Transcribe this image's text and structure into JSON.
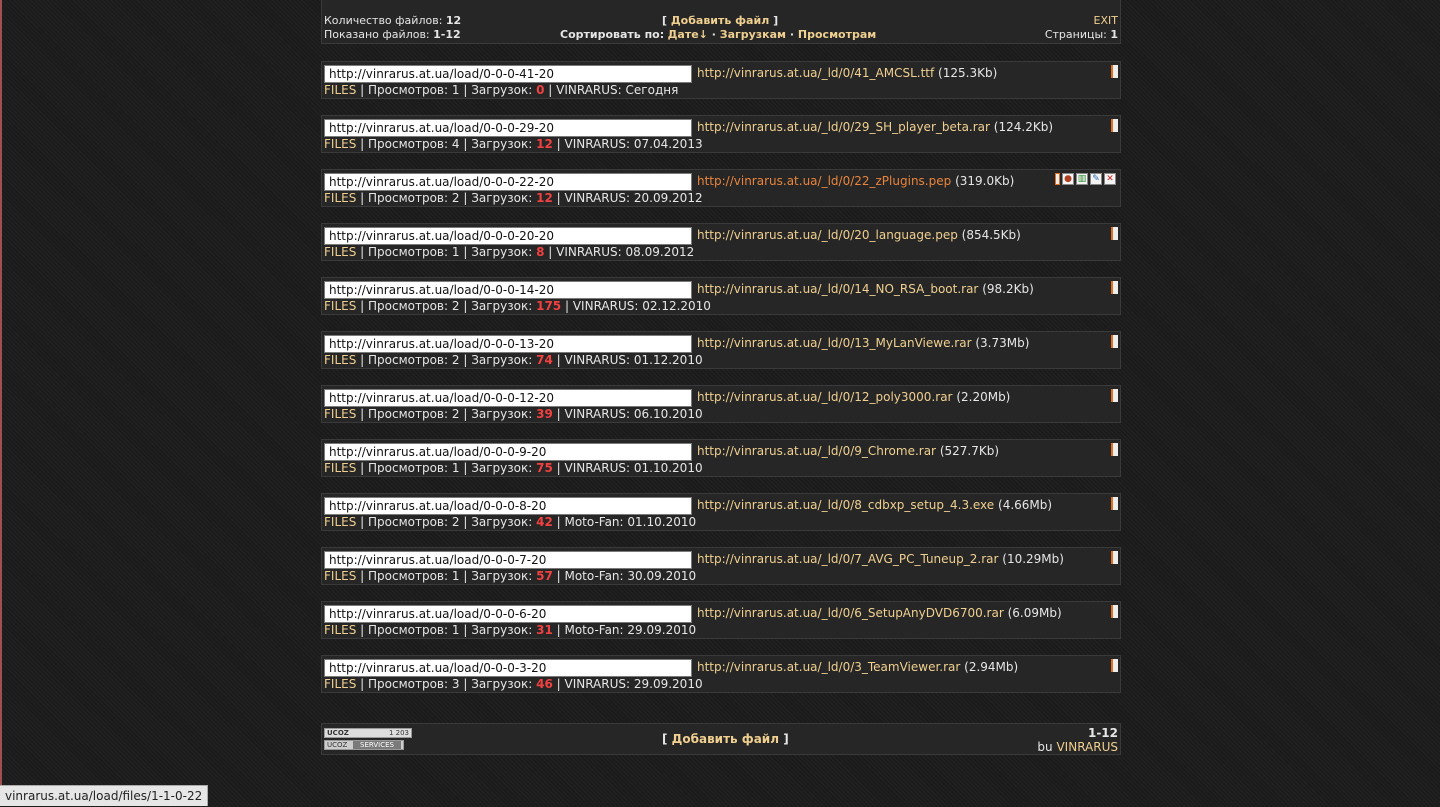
{
  "header": {
    "files_count_label": "Количество файлов:",
    "files_count": "12",
    "shown_label": "Показано файлов:",
    "shown_range": "1-12",
    "add_open": "[ ",
    "add_link": "Добавить файл",
    "add_close": " ]",
    "sort_label": "Сортировать по:",
    "sort_date": "Дате↓",
    "sort_downloads": "Загрузкам",
    "sort_views": "Просмотрам",
    "sep": " · ",
    "exit": "EXIT",
    "pages_label": "Страницы:",
    "pages_value": "1"
  },
  "labels": {
    "views": "Просмотров:",
    "downloads": "Загрузок:",
    "pipe": " | "
  },
  "files": [
    {
      "page_url": "http://vinrarus.at.ua/load/0-0-0-41-20",
      "download_url": "http://vinrarus.at.ua/_ld/0/41_AMCSL.ttf",
      "size": "(125.3Kb)",
      "category": "FILES",
      "views": "1",
      "downloads": "0",
      "author": "VINRARUS",
      "date": "Сегодня"
    },
    {
      "page_url": "http://vinrarus.at.ua/load/0-0-0-29-20",
      "download_url": "http://vinrarus.at.ua/_ld/0/29_SH_player_beta.rar",
      "size": "(124.2Kb)",
      "category": "FILES",
      "views": "4",
      "downloads": "12",
      "author": "VINRARUS",
      "date": "07.04.2013"
    },
    {
      "page_url": "http://vinrarus.at.ua/load/0-0-0-22-20",
      "download_url": "http://vinrarus.at.ua/_ld/0/22_zPlugins.pep",
      "size": "(319.0Kb)",
      "category": "FILES",
      "views": "2",
      "downloads": "12",
      "author": "VINRARUS",
      "date": "20.09.2012"
    },
    {
      "page_url": "http://vinrarus.at.ua/load/0-0-0-20-20",
      "download_url": "http://vinrarus.at.ua/_ld/0/20_language.pep",
      "size": "(854.5Kb)",
      "category": "FILES",
      "views": "1",
      "downloads": "8",
      "author": "VINRARUS",
      "date": "08.09.2012"
    },
    {
      "page_url": "http://vinrarus.at.ua/load/0-0-0-14-20",
      "download_url": "http://vinrarus.at.ua/_ld/0/14_NO_RSA_boot.rar",
      "size": "(98.2Kb)",
      "category": "FILES",
      "views": "2",
      "downloads": "175",
      "author": "VINRARUS",
      "date": "02.12.2010"
    },
    {
      "page_url": "http://vinrarus.at.ua/load/0-0-0-13-20",
      "download_url": "http://vinrarus.at.ua/_ld/0/13_MyLanViewe.rar",
      "size": "(3.73Mb)",
      "category": "FILES",
      "views": "2",
      "downloads": "74",
      "author": "VINRARUS",
      "date": "01.12.2010"
    },
    {
      "page_url": "http://vinrarus.at.ua/load/0-0-0-12-20",
      "download_url": "http://vinrarus.at.ua/_ld/0/12_poly3000.rar",
      "size": "(2.20Mb)",
      "category": "FILES",
      "views": "2",
      "downloads": "39",
      "author": "VINRARUS",
      "date": "06.10.2010"
    },
    {
      "page_url": "http://vinrarus.at.ua/load/0-0-0-9-20",
      "download_url": "http://vinrarus.at.ua/_ld/0/9_Chrome.rar",
      "size": "(527.7Kb)",
      "category": "FILES",
      "views": "1",
      "downloads": "75",
      "author": "VINRARUS",
      "date": "01.10.2010"
    },
    {
      "page_url": "http://vinrarus.at.ua/load/0-0-0-8-20",
      "download_url": "http://vinrarus.at.ua/_ld/0/8_cdbxp_setup_4.3.exe",
      "size": "(4.66Mb)",
      "category": "FILES",
      "views": "2",
      "downloads": "42",
      "author": "Moto-Fan",
      "date": "01.10.2010"
    },
    {
      "page_url": "http://vinrarus.at.ua/load/0-0-0-7-20",
      "download_url": "http://vinrarus.at.ua/_ld/0/7_AVG_PC_Tuneup_2.rar",
      "size": "(10.29Mb)",
      "category": "FILES",
      "views": "1",
      "downloads": "57",
      "author": "Moto-Fan",
      "date": "30.09.2010"
    },
    {
      "page_url": "http://vinrarus.at.ua/load/0-0-0-6-20",
      "download_url": "http://vinrarus.at.ua/_ld/0/6_SetupAnyDVD6700.rar",
      "size": "(6.09Mb)",
      "category": "FILES",
      "views": "1",
      "downloads": "31",
      "author": "Moto-Fan",
      "date": "29.09.2010"
    },
    {
      "page_url": "http://vinrarus.at.ua/load/0-0-0-3-20",
      "download_url": "http://vinrarus.at.ua/_ld/0/3_TeamViewer.rar",
      "size": "(2.94Mb)",
      "category": "FILES",
      "views": "3",
      "downloads": "46",
      "author": "VINRARUS",
      "date": "29.09.2010"
    }
  ],
  "footer": {
    "ucoz_counter_label": "UCOZ",
    "ucoz_counter_value": "1 203",
    "ucoz_services_label": "UCOZ",
    "ucoz_services_text": "SERVICES",
    "add_open": "[ ",
    "add_link": "Добавить файл",
    "add_close": " ]",
    "range": "1-12",
    "by_label": "bu",
    "by_author": "VINRARUS"
  },
  "status_bar": {
    "url": "vinrarus.at.ua/load/files/1-1-0-22"
  }
}
